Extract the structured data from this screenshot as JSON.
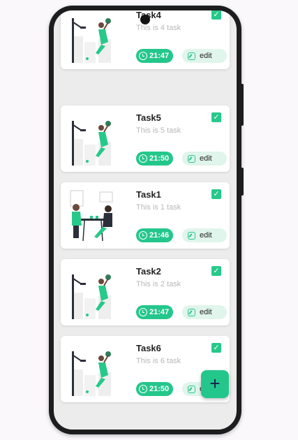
{
  "tasks": [
    {
      "title": "Task4",
      "description": "This is 4 task",
      "time": "21:47",
      "edit_label": "edit",
      "image": "basketball-dunk-illustration",
      "checked": true
    },
    {
      "title": "Task5",
      "description": "This is 5 task",
      "time": "21:50",
      "edit_label": "edit",
      "image": "basketball-dunk-illustration",
      "checked": true
    },
    {
      "title": "Task1",
      "description": "This is 1 task",
      "time": "21:46",
      "edit_label": "edit",
      "image": "two-people-at-table-illustration",
      "checked": true
    },
    {
      "title": "Task2",
      "description": "This is 2 task",
      "time": "21:47",
      "edit_label": "edit",
      "image": "basketball-dunk-illustration",
      "checked": true
    },
    {
      "title": "Task6",
      "description": "This is 6 task",
      "time": "21:50",
      "edit_label": "edit",
      "image": "basketball-dunk-illustration",
      "checked": true
    }
  ],
  "fab": {
    "label": "+",
    "icon": "plus-icon"
  },
  "colors": {
    "accent": "#24c78b",
    "chip_light": "#e0f5ec",
    "background": "#ececec",
    "fab_icon": "#16214d"
  },
  "icons": {
    "check": "check-icon",
    "clock": "clock-icon",
    "edit": "edit-icon"
  }
}
